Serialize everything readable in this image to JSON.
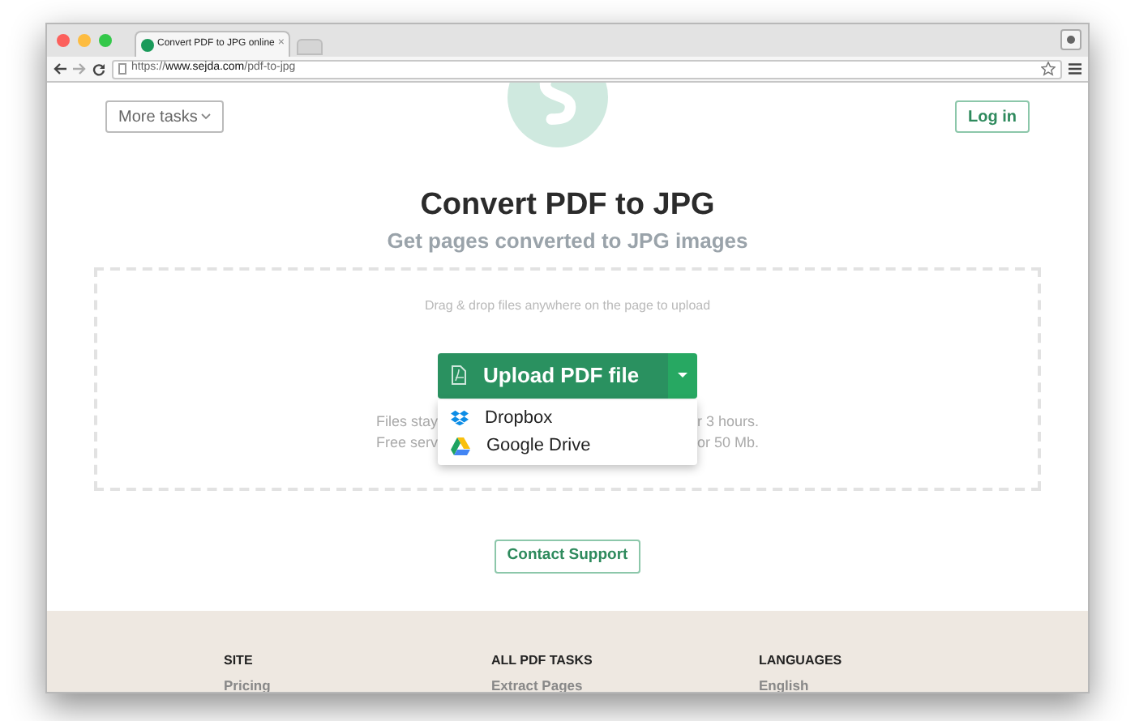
{
  "browser": {
    "tab_title": "Convert PDF to JPG online",
    "tab_close": "×",
    "url_prefix": "https://",
    "url_host": "www.sejda.com",
    "url_path": "/pdf-to-jpg"
  },
  "header": {
    "more_tasks": "More tasks",
    "login": "Log in"
  },
  "title": "Convert PDF to JPG",
  "subtitle": "Get pages converted to JPG images",
  "dropzone": {
    "hint": "Drag & drop files anywhere on the page to upload",
    "upload_button": "Upload PDF file",
    "menu": [
      {
        "label": "Dropbox",
        "kind": "dropbox"
      },
      {
        "label": "Google Drive",
        "kind": "drive"
      }
    ],
    "notes": [
      {
        "left": "Files stay",
        "right": "r 3 hours."
      },
      {
        "left": "Free serv",
        "right": "or 50 Mb."
      }
    ]
  },
  "contact_button": "Contact Support",
  "footer": [
    {
      "heading": "SITE",
      "link": "Pricing"
    },
    {
      "heading": "ALL PDF TASKS",
      "link": "Extract Pages"
    },
    {
      "heading": "LANGUAGES",
      "link": "English"
    }
  ]
}
